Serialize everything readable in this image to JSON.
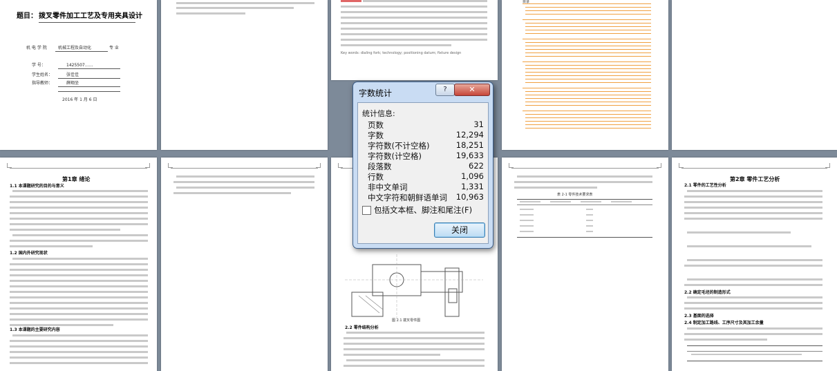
{
  "cover": {
    "title_label": "题目：",
    "title": "拨叉零件加工工艺及专用夹具设计",
    "school": "机 电 学 院",
    "major": "机械工程及自动化",
    "major_suffix": "专 业",
    "id_label": "学    号：",
    "id_value": "1425507……",
    "name_label": "学生姓名：",
    "name_value": "张佳佳",
    "advisor_label": "指导教师：",
    "advisor_value": "薛翔坐",
    "date": "2016 年 1 月 6 日"
  },
  "toc_label": "目录",
  "chapter1": {
    "title": "第1章 绪论",
    "s1": "1.1 本课题研究的目的与意义",
    "s2": "1.2 国内外研究现状",
    "s3": "1.3 本课题的主要研究内容"
  },
  "chapter2": {
    "title": "第2章 零件工艺分析",
    "s1": "2.1 零件的工艺性分析",
    "s2": "2.2 确定毛坯的制造形式",
    "s3": "2.3 基面的选择",
    "s4": "2.4 制定加工路线、工序尺寸及其加工余量"
  },
  "table_caption": "表 2-1 零件技术要求表",
  "figure_caption": "图 2.1 拨叉零件图",
  "section_22": "2.2 零件结构分析",
  "abstract_keywords": "Key words: dialing fork; technology; positioning datum; fixture design",
  "word_count_dialog": {
    "title": "字数统计",
    "help_label": "?",
    "close_label": "✕",
    "stats_heading": "统计信息:",
    "rows": [
      {
        "label": "页数",
        "value": "31"
      },
      {
        "label": "字数",
        "value": "12,294"
      },
      {
        "label": "字符数(不计空格)",
        "value": "18,251"
      },
      {
        "label": "字符数(计空格)",
        "value": "19,633"
      },
      {
        "label": "段落数",
        "value": "622"
      },
      {
        "label": "行数",
        "value": "1,096"
      },
      {
        "label": "非中文单词",
        "value": "1,331"
      },
      {
        "label": "中文字符和朝鲜语单词",
        "value": "10,963"
      }
    ],
    "checkbox_label": "包括文本框、脚注和尾注(F)",
    "checkbox_checked": false,
    "close_button": "关闭"
  }
}
